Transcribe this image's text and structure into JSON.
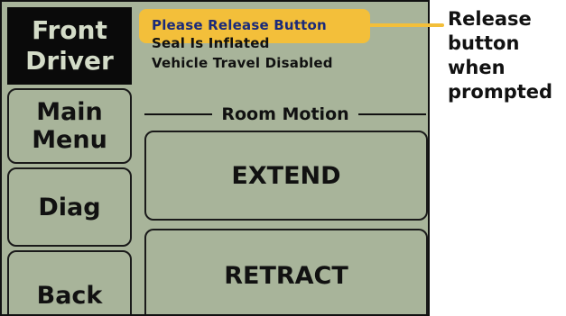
{
  "screen": {
    "header": {
      "line1": "Front",
      "line2": "Driver"
    },
    "sidebar": {
      "main_menu": {
        "line1": "Main",
        "line2": "Menu"
      },
      "diag": "Diag",
      "back": "Back"
    },
    "status": [
      "Please Release Button",
      "Seal Is Inflated",
      "Vehicle Travel Disabled"
    ],
    "room_motion": {
      "title": "Room Motion",
      "extend": "EXTEND",
      "retract": "RETRACT"
    }
  },
  "annotation": {
    "lines": [
      "Release",
      "button",
      "when",
      "prompted"
    ]
  },
  "colors": {
    "screen_bg": "#a8b49a",
    "highlight": "#f3bf3a",
    "header_bg": "#0a0a0a",
    "header_text": "#d4dcc8"
  }
}
